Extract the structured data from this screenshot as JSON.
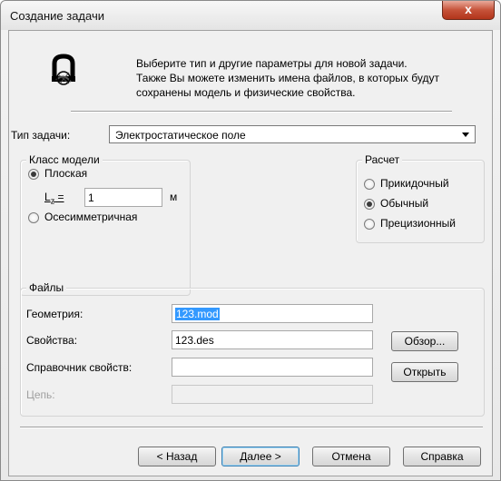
{
  "window": {
    "title": "Создание задачи",
    "close_label": "x"
  },
  "header": {
    "icon": "app-logo-icon",
    "line1": "Выберите тип и другие параметры для новой задачи.",
    "line2": "Также Вы можете изменить имена файлов, в которых будут",
    "line3": "сохранены модель и физические свойства."
  },
  "task_type": {
    "label": "Тип задачи:",
    "value": "Электростатическое поле"
  },
  "model_class": {
    "title": "Класс модели",
    "options": [
      {
        "label": "Плоская",
        "checked": true
      },
      {
        "label": "Осесимметричная",
        "checked": false
      }
    ],
    "lz_label": "L",
    "lz_sub": "z",
    "lz_eq": " =",
    "lz_value": "1",
    "lz_unit": "м"
  },
  "calculation": {
    "title": "Расчет",
    "options": [
      {
        "label": "Прикидочный",
        "checked": false
      },
      {
        "label": "Обычный",
        "checked": true
      },
      {
        "label": "Прецизионный",
        "checked": false
      }
    ]
  },
  "files": {
    "title": "Файлы",
    "geometry_label": "Геометрия:",
    "geometry_value": "123.mod",
    "properties_label": "Свойства:",
    "properties_value": "123.des",
    "reference_label": "Справочник свойств:",
    "reference_value": "",
    "chain_label": "Цепь:",
    "chain_value": "",
    "browse_label": "Обзор...",
    "open_label": "Открыть"
  },
  "footer": {
    "back_label": "< Назад",
    "next_label": "Далее >",
    "cancel_label": "Отмена",
    "help_label": "Справка"
  }
}
